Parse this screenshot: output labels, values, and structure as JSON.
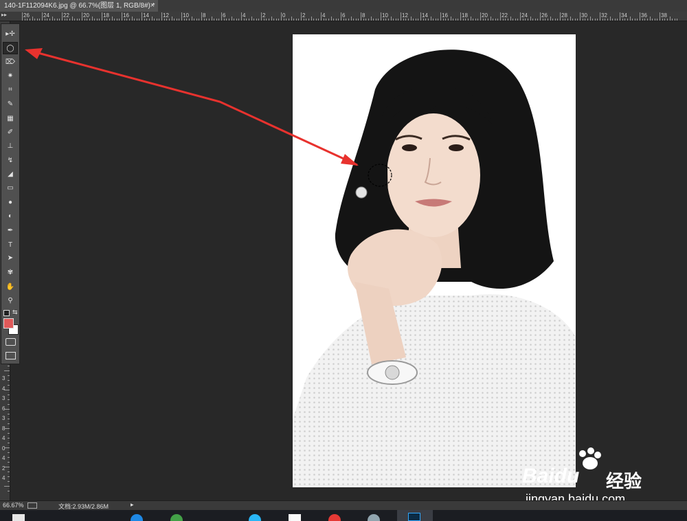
{
  "document": {
    "tab_title": "140-1F112094K6.jpg @ 66.7%(图层 1, RGB/8#) *",
    "close_glyph": "×"
  },
  "ruler": {
    "top_labels": [
      "26",
      "24",
      "22",
      "20",
      "18",
      "16",
      "14",
      "12",
      "10",
      "8",
      "6",
      "4",
      "2",
      "0",
      "2",
      "4",
      "6",
      "8",
      "10",
      "12",
      "14",
      "16",
      "18",
      "20",
      "22",
      "24",
      "26",
      "28",
      "30",
      "32",
      "34",
      "36",
      "38"
    ],
    "left_labels": [
      "3",
      "4",
      "3",
      "6",
      "3",
      "8",
      "4",
      "0",
      "4",
      "2",
      "4"
    ]
  },
  "tools": [
    {
      "name": "move-tool",
      "icon": "move-icon",
      "glyph": "▸✢"
    },
    {
      "name": "elliptical-marquee-tool",
      "icon": "ellipse-marquee-icon",
      "glyph": "◯",
      "active": true
    },
    {
      "name": "lasso-tool",
      "icon": "polygonal-lasso-icon",
      "glyph": "⌦"
    },
    {
      "name": "magic-wand-tool",
      "icon": "magic-wand-icon",
      "glyph": "✷"
    },
    {
      "name": "crop-tool",
      "icon": "crop-icon",
      "glyph": "⌗"
    },
    {
      "name": "eyedropper-tool",
      "icon": "eyedropper-icon",
      "glyph": "✎"
    },
    {
      "name": "spot-healing-tool",
      "icon": "bandage-icon",
      "glyph": "▦"
    },
    {
      "name": "brush-tool",
      "icon": "brush-icon",
      "glyph": "✐"
    },
    {
      "name": "clone-stamp-tool",
      "icon": "stamp-icon",
      "glyph": "⊥"
    },
    {
      "name": "history-brush-tool",
      "icon": "history-brush-icon",
      "glyph": "↯"
    },
    {
      "name": "eraser-tool",
      "icon": "eraser-icon",
      "glyph": "◢"
    },
    {
      "name": "gradient-tool",
      "icon": "gradient-icon",
      "glyph": "▭"
    },
    {
      "name": "blur-tool",
      "icon": "drop-icon",
      "glyph": "●"
    },
    {
      "name": "dodge-tool",
      "icon": "dodge-icon",
      "glyph": "◐"
    },
    {
      "name": "pen-tool",
      "icon": "pen-icon",
      "glyph": "✒"
    },
    {
      "name": "type-tool",
      "icon": "type-icon",
      "glyph": "T"
    },
    {
      "name": "path-selection-tool",
      "icon": "arrow-icon",
      "glyph": "➤"
    },
    {
      "name": "shape-tool",
      "icon": "custom-shape-icon",
      "glyph": "✾"
    },
    {
      "name": "hand-tool",
      "icon": "hand-icon",
      "glyph": "✋"
    },
    {
      "name": "zoom-tool",
      "icon": "magnifier-icon",
      "glyph": "⚲"
    }
  ],
  "colors": {
    "foreground": "#e05a5a",
    "background": "#ffffff",
    "annotation_arrow": "#e8322e",
    "canvas": "#ffffff",
    "workspace": "#282828"
  },
  "status": {
    "zoom": "66.67%",
    "doc_info": "文档:2.93M/2.86M",
    "arrow": "▸"
  },
  "watermark": {
    "brand": "Baidu",
    "cn": "经验",
    "url": "jingyan.baidu.com"
  }
}
